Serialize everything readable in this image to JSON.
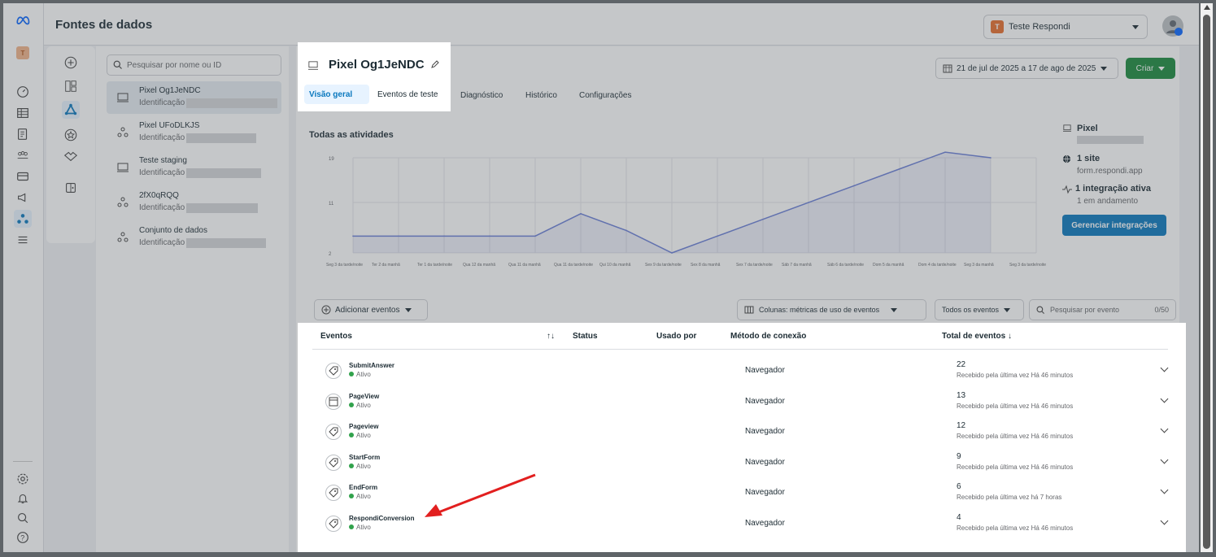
{
  "header": {
    "title": "Fontes de dados",
    "account_initial": "T",
    "account_name": "Teste Respondi"
  },
  "search": {
    "placeholder": "Pesquisar por nome ou ID"
  },
  "datasources": [
    {
      "name": "Pixel Og1JeNDC",
      "id_label": "Identificação",
      "type": "pixel",
      "selected": true
    },
    {
      "name": "Pixel UFoDLKJS",
      "id_label": "Identificação",
      "type": "dataset",
      "selected": false
    },
    {
      "name": "Teste staging",
      "id_label": "Identificação",
      "type": "pixel",
      "selected": false
    },
    {
      "name": "2fX0qRQQ",
      "id_label": "Identificação",
      "type": "dataset",
      "selected": false
    },
    {
      "name": "Conjunto de dados",
      "id_label": "Identificação",
      "type": "dataset",
      "selected": false
    }
  ],
  "pixel": {
    "title": "Pixel Og1JeNDC"
  },
  "tabs": [
    {
      "label": "Visão geral",
      "active": true
    },
    {
      "label": "Eventos de teste",
      "active": false
    },
    {
      "label": "Diagnóstico",
      "active": false
    },
    {
      "label": "Histórico",
      "active": false
    },
    {
      "label": "Configurações",
      "active": false
    }
  ],
  "date_range": "21 de jul de 2025 a 17 de ago de 2025",
  "create_button": "Criar",
  "activity": {
    "title": "Todas as atividades"
  },
  "chart_data": {
    "type": "area",
    "yticks": [
      19,
      11,
      2
    ],
    "ylim": [
      2,
      19
    ],
    "x": [
      "Seg 3 da tarde/noite",
      "Ter 2 da manhã",
      "Ter 1 da tarde/noite",
      "Qua 12 da manhã",
      "Qua 11 da manhã",
      "Qua 11 da tarde/noite",
      "Qui 10 da manhã",
      "Sex 9 da tarde/noite",
      "Sex 8 da manhã",
      "Sex 7 da tarde/noite",
      "Sáb 7 da manhã",
      "Sáb 6 da tarde/noite",
      "Dom 5 da manhã",
      "Dom 4 da tarde/noite",
      "Seg 3 da manhã",
      "Seg 3 da tarde/noite"
    ],
    "series": [
      {
        "values": [
          5,
          5,
          5,
          5,
          5,
          9,
          6,
          2,
          5,
          8,
          11,
          14,
          17,
          20,
          19
        ]
      }
    ],
    "color": "#6b7fd7",
    "grid": true
  },
  "sidebar_info": {
    "pixel_label": "Pixel",
    "site_label": "1 site",
    "site_domain": "form.respondi.app",
    "integration_label": "1 integração ativa",
    "integration_status": "1 em andamento",
    "manage_button": "Gerenciar integrações"
  },
  "toolbar": {
    "add_events": "Adicionar eventos",
    "columns": "Colunas: métricas de uso de eventos",
    "all_events": "Todos os eventos",
    "search_placeholder": "Pesquisar por evento",
    "search_count": "0/50"
  },
  "table": {
    "headers": {
      "events": "Eventos",
      "sort": "↑↓",
      "status": "Status",
      "used_by": "Usado por",
      "method": "Método de conexão",
      "total": "Total de eventos ↓"
    },
    "rows": [
      {
        "name": "SubmitAnswer",
        "status": "Ativo",
        "method": "Navegador",
        "total": "22",
        "received": "Recebido pela última vez Há 46 minutos",
        "icon": "tag"
      },
      {
        "name": "PageView",
        "status": "Ativo",
        "method": "Navegador",
        "total": "13",
        "received": "Recebido pela última vez Há 46 minutos",
        "icon": "page"
      },
      {
        "name": "Pageview",
        "status": "Ativo",
        "method": "Navegador",
        "total": "12",
        "received": "Recebido pela última vez Há 46 minutos",
        "icon": "tag"
      },
      {
        "name": "StartForm",
        "status": "Ativo",
        "method": "Navegador",
        "total": "9",
        "received": "Recebido pela última vez Há 46 minutos",
        "icon": "tag"
      },
      {
        "name": "EndForm",
        "status": "Ativo",
        "method": "Navegador",
        "total": "6",
        "received": "Recebido pela última vez há 7 horas",
        "icon": "tag"
      },
      {
        "name": "RespondiConversion",
        "status": "Ativo",
        "method": "Navegador",
        "total": "4",
        "received": "Recebido pela última vez Há 46 minutos",
        "icon": "tag"
      }
    ]
  },
  "colors": {
    "accent": "#0a78be",
    "green": "#1a8a3c",
    "arrow": "#e21f1f"
  }
}
